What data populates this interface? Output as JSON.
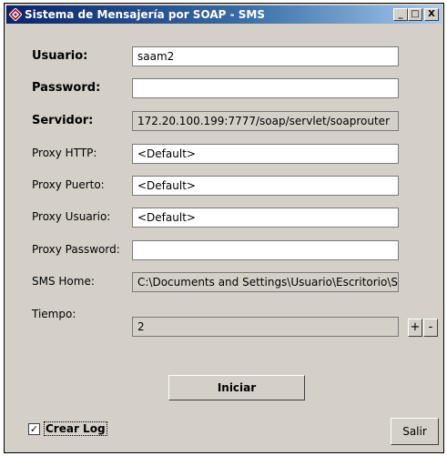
{
  "window": {
    "title": "Sistema de Mensajería por SOAP - SMS"
  },
  "titlebar_buttons": {
    "minimize": "_",
    "maximize": "□",
    "close": "X"
  },
  "form": {
    "usuario": {
      "label": "Usuario:",
      "value": "saam2"
    },
    "password": {
      "label": "Password:",
      "value": ""
    },
    "servidor": {
      "label": "Servidor:",
      "value": "172.20.100.199:7777/soap/servlet/soaprouter"
    },
    "proxy_http": {
      "label": "Proxy HTTP:",
      "value": "<Default>"
    },
    "proxy_puerto": {
      "label": "Proxy Puerto:",
      "value": "<Default>"
    },
    "proxy_usuario": {
      "label": "Proxy Usuario:",
      "value": "<Default>"
    },
    "proxy_password": {
      "label": "Proxy Password:",
      "value": ""
    },
    "sms_home": {
      "label": "SMS Home:",
      "value": "C:\\Documents and Settings\\Usuario\\Escritorio\\S"
    },
    "tiempo": {
      "label": "Tiempo:",
      "value": "2"
    }
  },
  "stepper": {
    "plus": "+",
    "minus": "-"
  },
  "buttons": {
    "iniciar": "Iniciar",
    "salir": "Salir"
  },
  "crear_log": {
    "label": "Crear Log",
    "checked": true,
    "mark": "✓"
  },
  "colors": {
    "titlebar_start": "#0a246a",
    "titlebar_end": "#a6caf0",
    "window_bg": "#d4d0c8"
  }
}
